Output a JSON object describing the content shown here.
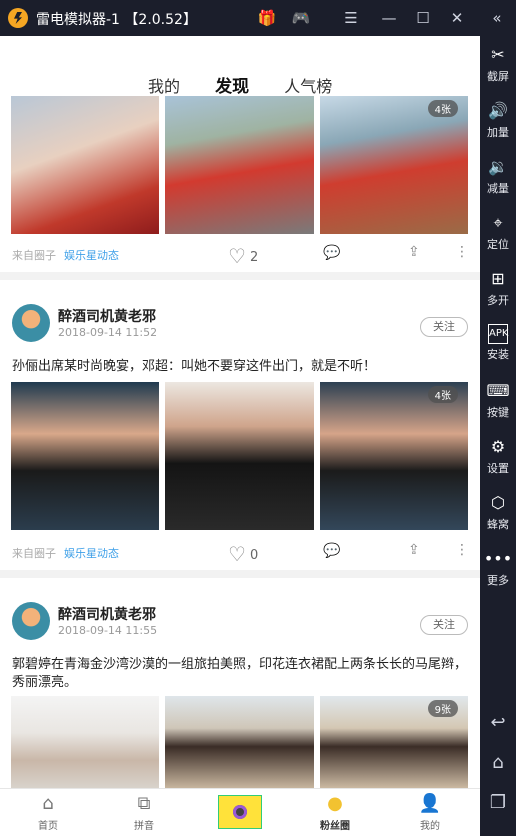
{
  "window": {
    "title": "雷电模拟器-1 【2.0.52】",
    "icons": [
      "gift-icon",
      "gamepad-icon",
      "menu-icon",
      "minimize-icon",
      "maximize-icon",
      "close-icon",
      "collapse-icon"
    ]
  },
  "sidebar": {
    "items": [
      {
        "label": "截屏",
        "icon": "scissors-icon"
      },
      {
        "label": "加量",
        "icon": "volume-up-icon"
      },
      {
        "label": "减量",
        "icon": "volume-down-icon"
      },
      {
        "label": "定位",
        "icon": "location-icon"
      },
      {
        "label": "多开",
        "icon": "multi-instance-icon"
      },
      {
        "label": "安装",
        "icon": "apk-icon"
      },
      {
        "label": "按键",
        "icon": "keyboard-icon"
      },
      {
        "label": "设置",
        "icon": "gear-icon"
      },
      {
        "label": "蜂窝",
        "icon": "hive-icon"
      },
      {
        "label": "更多",
        "icon": "more-icon"
      }
    ],
    "nav": [
      "back-icon",
      "home-icon",
      "recent-apps-icon"
    ]
  },
  "app": {
    "tabs": [
      "我的",
      "发现",
      "人气榜"
    ],
    "active_tab": "发现",
    "post1": {
      "source_prefix": "来自圈子",
      "source": "娱乐星动态",
      "likes": "2",
      "badge": "4张"
    },
    "post2": {
      "user": "醉酒司机黄老邪",
      "date": "2018-09-14  11:52",
      "follow": "关注",
      "text": "孙俪出席某时尚晚宴，邓超：叫她不要穿这件出门，就是不听！",
      "badge": "4张",
      "source_prefix": "来自圈子",
      "source": "娱乐星动态",
      "likes": "0"
    },
    "post3": {
      "user": "醉酒司机黄老邪",
      "date": "2018-09-14  11:55",
      "follow": "关注",
      "text": "郭碧婷在青海金沙湾沙漠的一组旅拍美照，印花连衣裙配上两条长长的马尾辫，秀丽漂亮。",
      "badge": "9张"
    },
    "bottom_nav": [
      {
        "label": "首页",
        "icon": "home-icon"
      },
      {
        "label": "拼音",
        "icon": "puzzle-icon"
      },
      {
        "label": "",
        "icon": "camera-icon"
      },
      {
        "label": "粉丝圈",
        "icon": "fan-circle-icon"
      },
      {
        "label": "我的",
        "icon": "user-icon"
      }
    ],
    "colors": {
      "link": "#3fa0e8",
      "titlebar": "#1b1e2b",
      "camera": "#ffe23a"
    }
  }
}
